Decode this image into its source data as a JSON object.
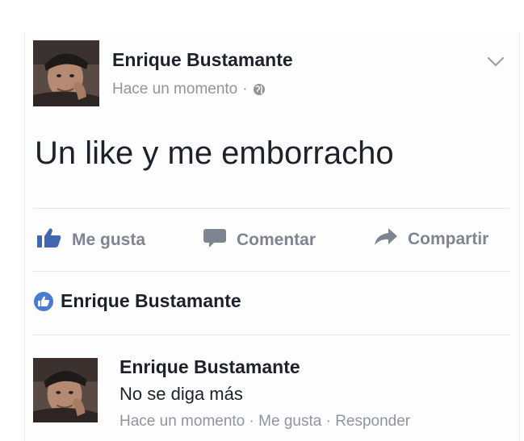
{
  "post": {
    "author": "Enrique Bustamante",
    "time": "Hace un momento",
    "separator": "·",
    "privacy_icon": "globe-icon",
    "text": "Un like y me emborracho"
  },
  "actions": {
    "like_label": "Me gusta",
    "comment_label": "Comentar",
    "share_label": "Compartir"
  },
  "likes": {
    "name": "Enrique Bustamante"
  },
  "comment": {
    "author": "Enrique Bustamante",
    "text": "No se diga más",
    "time": "Hace un momento",
    "like_link": "Me gusta",
    "reply_link": "Responder",
    "separator": "·"
  },
  "colors": {
    "name_text": "#1d2129",
    "meta_text": "#90949c",
    "action_text": "#7f8590",
    "like_blue": "#4267b2"
  }
}
